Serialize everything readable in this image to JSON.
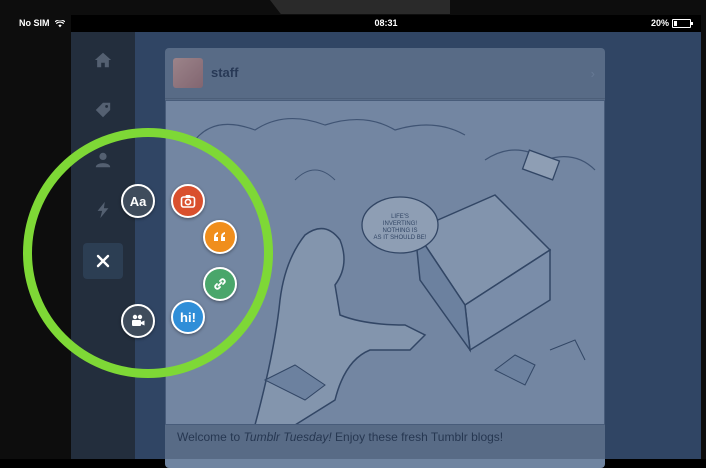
{
  "status_bar": {
    "carrier": "No SIM",
    "time": "08:31",
    "battery_percent": "20%",
    "battery_level": 0.2
  },
  "sidebar": {
    "items": [
      {
        "icon": "home-icon"
      },
      {
        "icon": "tag-icon"
      },
      {
        "icon": "person-icon"
      },
      {
        "icon": "lightning-icon"
      }
    ]
  },
  "post": {
    "username": "staff",
    "comic_text": "LIFE'S INVERTING! NOTHING IS AS IT SHOULD BE!",
    "caption_prefix": "Welcome to ",
    "caption_em": "Tumblr Tuesday!",
    "caption_suffix": " Enjoy these fresh Tumblr blogs!"
  },
  "compose_menu": {
    "close_icon": "close-icon",
    "buttons": [
      {
        "type": "text",
        "label": "Aa",
        "color": "#3f4c5c"
      },
      {
        "type": "photo",
        "icon": "camera-icon",
        "color": "#d9502e"
      },
      {
        "type": "quote",
        "label": "66",
        "color": "#f08e1c"
      },
      {
        "type": "link",
        "icon": "link-icon",
        "color": "#4aa66b"
      },
      {
        "type": "chat",
        "label": "hi!",
        "color": "#2f8ed8"
      },
      {
        "type": "video",
        "icon": "video-camera-icon",
        "color": "#3f4c5c"
      }
    ],
    "highlight_color": "#7ed836"
  }
}
